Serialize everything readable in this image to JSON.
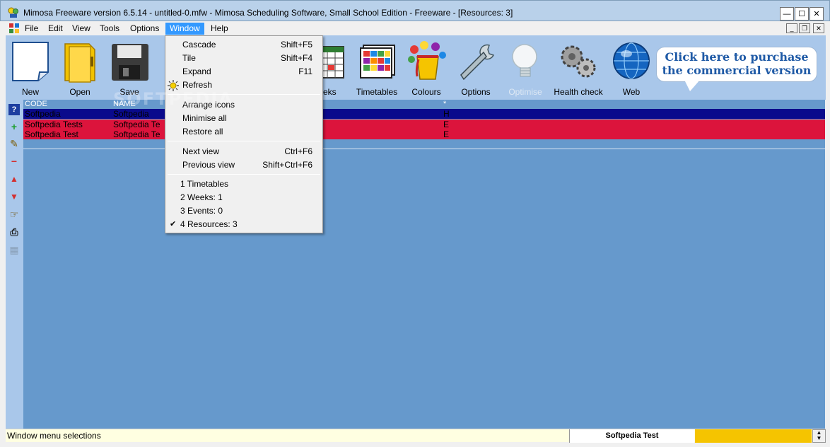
{
  "window": {
    "title": "Mimosa Freeware version 6.5.14 - untitled-0.mfw - Mimosa Scheduling Software, Small School Edition - Freeware - [Resources: 3]",
    "minimize_glyph": "—",
    "maximize_glyph": "☐",
    "close_glyph": "✕"
  },
  "menubar": {
    "items": [
      "File",
      "Edit",
      "View",
      "Tools",
      "Options",
      "Window",
      "Help"
    ],
    "active": "Window",
    "mdi_minimize_glyph": "_",
    "mdi_restore_glyph": "❐",
    "mdi_close_glyph": "✕"
  },
  "toolbar": {
    "buttons": [
      {
        "label": "New",
        "icon": "new-document-icon"
      },
      {
        "label": "Open",
        "icon": "open-folder-icon"
      },
      {
        "label": "Save",
        "icon": "floppy-disk-icon"
      },
      {
        "label": "eeks",
        "icon": "calendar-icon"
      },
      {
        "label": "Timetables",
        "icon": "timetables-icon"
      },
      {
        "label": "Colours",
        "icon": "paint-bucket-icon"
      },
      {
        "label": "Options",
        "icon": "wrench-icon"
      },
      {
        "label": "Optimise",
        "icon": "light-bulb-icon",
        "disabled": true
      },
      {
        "label": "Health check",
        "icon": "gears-icon"
      },
      {
        "label": "Web",
        "icon": "globe-icon"
      }
    ]
  },
  "purchase": {
    "line1": "Click  here to purchase",
    "line2": "the commercial  version"
  },
  "sidebar": {
    "icons": [
      "help-icon",
      "add-icon",
      "edit-pencil-icon",
      "remove-icon",
      "move-up-icon",
      "move-down-icon",
      "assign-icon",
      "print-icon",
      "grid-icon"
    ],
    "help_glyph": "?",
    "add_glyph": "+",
    "edit_glyph": "✎",
    "remove_glyph": "−",
    "up_glyph": "▲",
    "down_glyph": "▼",
    "assign_glyph": "☞",
    "print_glyph": "⎙",
    "grid_glyph": "▦"
  },
  "grid": {
    "headers": {
      "code": "CODE",
      "name": "NAME",
      "extra": "*"
    },
    "rows": [
      {
        "code": "Softpedia",
        "name": "Softpedia",
        "extra": "H",
        "color": "#0a0a8c"
      },
      {
        "code": "Softpedia Tests",
        "name": "Softpedia Te",
        "extra": "E",
        "color": "#dc143c"
      },
      {
        "code": "Softpedia Test",
        "name": "Softpedia Te",
        "extra": "E",
        "color": "#dc143c"
      }
    ]
  },
  "dropdown": {
    "items": [
      {
        "label": "Cascade",
        "shortcut": "Shift+F5"
      },
      {
        "label": "Tile",
        "shortcut": "Shift+F4"
      },
      {
        "label": "Expand",
        "shortcut": "F11"
      },
      {
        "label": "Refresh",
        "shortcut": "",
        "icon": "refresh-sun-icon"
      },
      {
        "label": "Arrange icons",
        "shortcut": ""
      },
      {
        "label": "Minimise all",
        "shortcut": ""
      },
      {
        "label": "Restore all",
        "shortcut": ""
      },
      {
        "label": "Next view",
        "shortcut": "Ctrl+F6"
      },
      {
        "label": "Previous view",
        "shortcut": "Shift+Ctrl+F6"
      },
      {
        "label": "1 Timetables",
        "shortcut": ""
      },
      {
        "label": "2 Weeks: 1",
        "shortcut": ""
      },
      {
        "label": "3 Events: 0",
        "shortcut": ""
      },
      {
        "label": "4 Resources: 3",
        "shortcut": "",
        "checked": true
      }
    ],
    "check_glyph": "✔"
  },
  "status": {
    "text": "Window menu selections",
    "name": "Softpedia Test",
    "spin_up": "▲",
    "spin_down": "▼"
  },
  "watermark": "SOFTPEDIA",
  "colors": {
    "client_bg": "#6699cc",
    "toolbar_bg": "#a9c7ea",
    "selection": "#3399ff",
    "row_highlight": "#0a0a8c",
    "row_red": "#dc143c",
    "status_fill": "#f5c400"
  }
}
